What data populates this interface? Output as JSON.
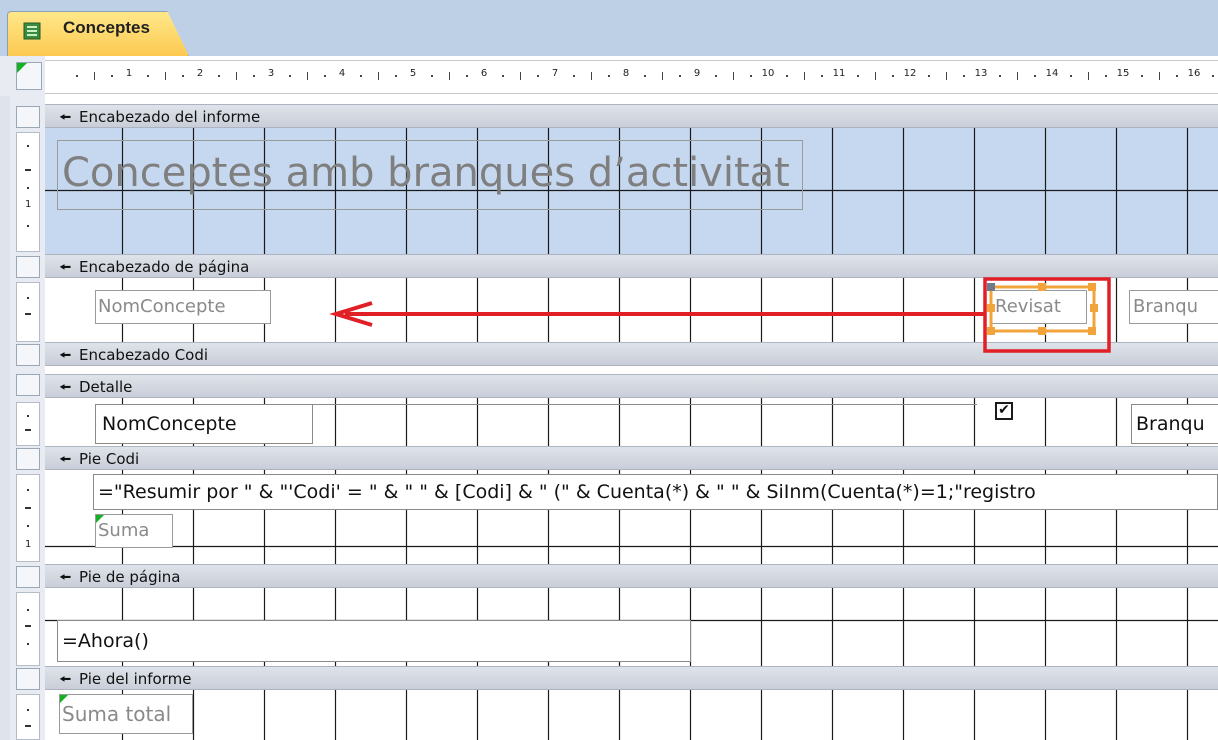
{
  "tab": {
    "title": "Conceptes",
    "icon": "report-icon"
  },
  "ruler": {
    "numbers": [
      "1",
      "2",
      "3",
      "4",
      "5",
      "6",
      "7",
      "8",
      "9",
      "10",
      "11",
      "12",
      "13",
      "14",
      "15",
      "16"
    ]
  },
  "sections": {
    "report_header": "Encabezado del informe",
    "page_header": "Encabezado de página",
    "group_header": "Encabezado Codi",
    "detail": "Detalle",
    "group_footer": "Pie Codi",
    "page_footer": "Pie de página",
    "report_footer": "Pie del informe"
  },
  "controls": {
    "report_title": "Conceptes amb branques d’activitat",
    "nom_concepte_label": "NomConcepte",
    "revisat_label": "Revisat",
    "branques_label": "Branqu",
    "nom_concepte_field": "NomConcepte",
    "revisat_checkbox": "✔",
    "branques_field": "Branqu",
    "summary_expression": "=\"Resumir por \" & \"'Codi' = \" & \" \" & [Codi] & \" (\" & Cuenta(*) & \" \" & SiInm(Cuenta(*)=1;\"registro",
    "suma_label": "Suma",
    "ahora_field": "=Ahora()",
    "suma_total_label": "Suma total"
  },
  "vruler": {
    "one": "1"
  },
  "colors": {
    "header_band": "#c5d8ef",
    "grid": "#1a1a1a",
    "annotation": "#e01f26",
    "selection": "#f2a43a"
  }
}
